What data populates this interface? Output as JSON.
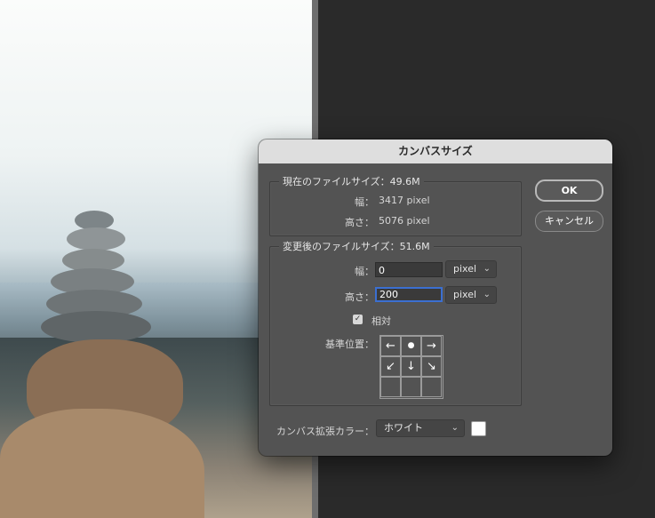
{
  "dialog": {
    "title": "カンバスサイズ",
    "current": {
      "legend": "現在のファイルサイズ：49.6M",
      "width_label": "幅：",
      "width_value": "3417 pixel",
      "height_label": "高さ：",
      "height_value": "5076 pixel"
    },
    "new": {
      "legend": "変更後のファイルサイズ：51.6M",
      "width_label": "幅：",
      "width_input": "0",
      "width_unit": "pixel",
      "height_label": "高さ：",
      "height_input": "200",
      "height_unit": "pixel",
      "relative_label": "相対",
      "relative_checked": true,
      "anchor_label": "基準位置："
    },
    "extension": {
      "label": "カンバス拡張カラー：",
      "selected": "ホワイト",
      "swatch_color": "#ffffff"
    },
    "buttons": {
      "ok": "OK",
      "cancel": "キャンセル"
    }
  },
  "icons": {
    "chevron": "⌄",
    "check": "✓",
    "anchor_cells": [
      "←",
      "●",
      "→",
      "↙",
      "↓",
      "↘",
      "",
      "",
      ""
    ]
  }
}
